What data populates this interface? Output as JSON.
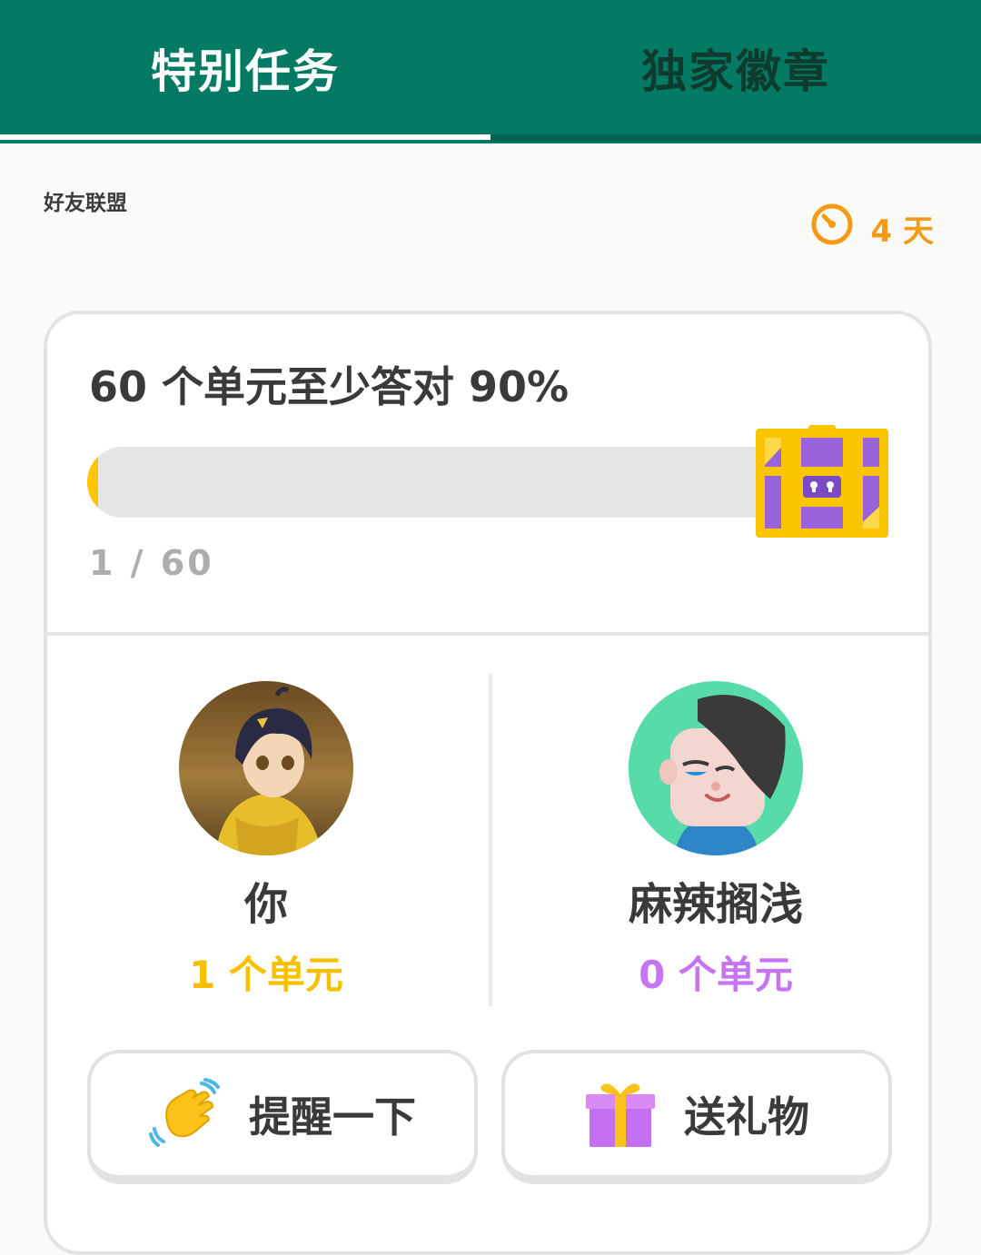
{
  "tabs": [
    {
      "label": "特别任务",
      "active": true
    },
    {
      "label": "独家徽章",
      "active": false
    }
  ],
  "section_label": "好友联盟",
  "timer": {
    "icon": "clock-icon",
    "text": "4 天",
    "color": "#f59a14"
  },
  "quest": {
    "title": "60 个单元至少答对 90%",
    "progress_current": 1,
    "progress_total": 60,
    "progress_text": "1 / 60",
    "reward_icon": "treasure-chest-icon"
  },
  "participants": {
    "you": {
      "name": "你",
      "units": "1 个单元",
      "color": "#f5c000"
    },
    "friend": {
      "name": "麻辣搁浅",
      "units": "0 个单元",
      "color": "#c774f3"
    }
  },
  "actions": {
    "nudge": {
      "label": "提醒一下",
      "icon": "waving-hand-icon"
    },
    "gift": {
      "label": "送礼物",
      "icon": "gift-icon"
    }
  },
  "colors": {
    "header": "#037a64",
    "accent_yellow": "#fdc600",
    "accent_purple": "#c774f3"
  }
}
